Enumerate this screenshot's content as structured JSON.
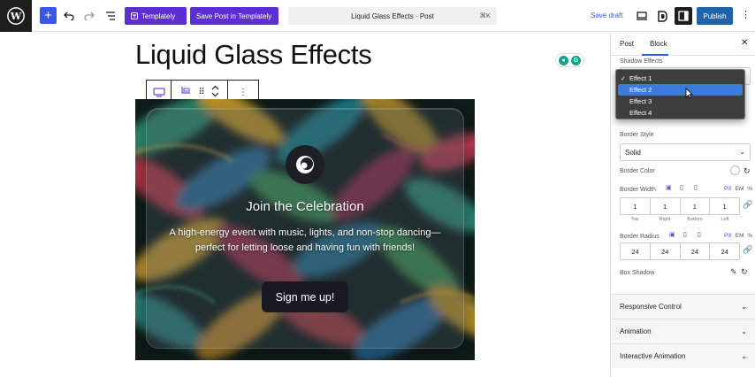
{
  "topbar": {
    "templately_label": "Templately",
    "save_templately_label": "Save Post in Templately",
    "command_title": "Liquid Glass Effects · Post",
    "command_shortcut": "⌘K",
    "save_draft_label": "Save draft",
    "publish_label": "Publish"
  },
  "post": {
    "title": "Liquid Glass Effects"
  },
  "hero": {
    "heading": "Join the Celebration",
    "text": "A high-energy event with music, lights, and non-stop dancing—perfect for letting loose and having fun with friends!",
    "button_label": "Sign me up!"
  },
  "sidebar": {
    "tab_post": "Post",
    "tab_block": "Block",
    "shadow_effects_label": "Shadow Effects",
    "shadow_effect_options": [
      "Effect 1",
      "Effect 2",
      "Effect 3",
      "Effect 4"
    ],
    "shadow_effect_selected": "Effect 1",
    "shadow_effect_hovered": "Effect 2",
    "border_style_label": "Border Style",
    "border_style_value": "Solid",
    "border_color_label": "Border Color",
    "border_width_label": "Border Width",
    "border_width_units": [
      "PX",
      "EM",
      "%"
    ],
    "border_width_values": [
      "1",
      "1",
      "1",
      "1"
    ],
    "side_labels": [
      "Top",
      "Right",
      "Bottom",
      "Left"
    ],
    "border_radius_label": "Border Radius",
    "border_radius_units": [
      "PX",
      "EM",
      "%"
    ],
    "border_radius_values": [
      "24",
      "24",
      "24",
      "24"
    ],
    "box_shadow_label": "Box Shadow",
    "panels": [
      "Responsive Control",
      "Animation",
      "Interactive Animation"
    ]
  },
  "colors": {
    "accent": "#3858e9",
    "templately_purple": "#5b2fd1",
    "publish_blue": "#1f63a8",
    "dropdown_bg": "#3e3e3e",
    "dropdown_hover": "#3a7bdc"
  }
}
